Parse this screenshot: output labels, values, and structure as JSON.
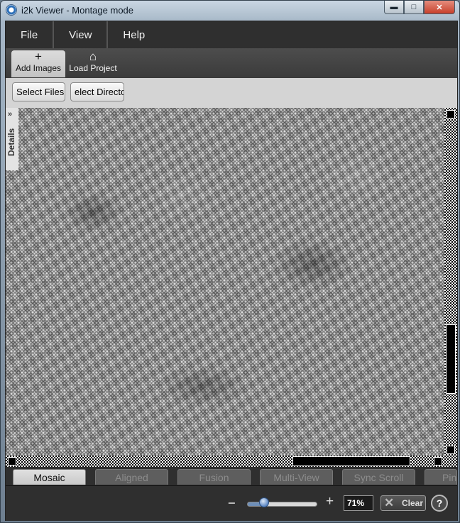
{
  "window": {
    "title": "i2k Viewer - Montage mode",
    "controls": {
      "minimize": "▬",
      "maximize": "□",
      "close": "✕"
    }
  },
  "menubar": {
    "items": [
      "File",
      "View",
      "Help"
    ]
  },
  "toolbar": {
    "add_images": {
      "label": "Add Images",
      "icon": "+"
    },
    "load_project": {
      "label": "Load Project",
      "icon": "⌂"
    }
  },
  "subbar": {
    "select_files": "Select Files",
    "select_directory": "elect Directo"
  },
  "viewer": {
    "details_tab": "Details",
    "details_chevron": "»"
  },
  "tabs": [
    "Mosaic",
    "Aligned",
    "Fusion",
    "Multi-View",
    "Sync Scroll",
    "Pin"
  ],
  "active_tab": "Mosaic",
  "statusbar": {
    "zoom_minus": "−",
    "zoom_plus": "+",
    "zoom_value": "71%",
    "zoom_fraction": 0.2,
    "clear": "Clear",
    "clear_icon": "✕",
    "help": "?"
  },
  "colors": {
    "accent": "#5a86c4",
    "menubar": "#2f2f2f",
    "subbar": "#d4d4d4"
  }
}
